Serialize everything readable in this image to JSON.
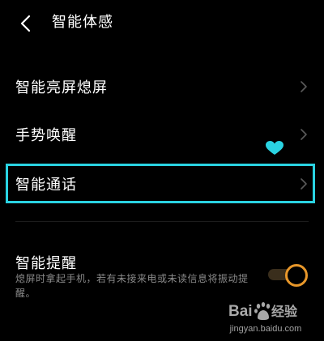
{
  "header": {
    "back_icon": "chevron-left-icon",
    "title": "智能体感"
  },
  "settings": {
    "items": [
      {
        "label": "智能亮屏熄屏",
        "icon": "chevron-right-icon"
      },
      {
        "label": "手势唤醒",
        "icon": "chevron-right-icon"
      },
      {
        "label": "智能通话",
        "icon": "chevron-right-icon",
        "highlighted": true
      }
    ]
  },
  "smart_reminder": {
    "label": "智能提醒",
    "description": "熄屏时拿起手机，若有未接来电或未读信息将振动提醒。",
    "enabled": true
  },
  "annotation": {
    "highlight_color": "#2ad3e2",
    "heart_icon": "heart-icon"
  },
  "watermark": {
    "brand": "Baidu经验",
    "url": "jingyan.baidu.com"
  },
  "colors": {
    "background": "#000000",
    "text": "#ffffff",
    "secondary_text": "#8a8a8a",
    "toggle_accent": "#e8972a"
  }
}
